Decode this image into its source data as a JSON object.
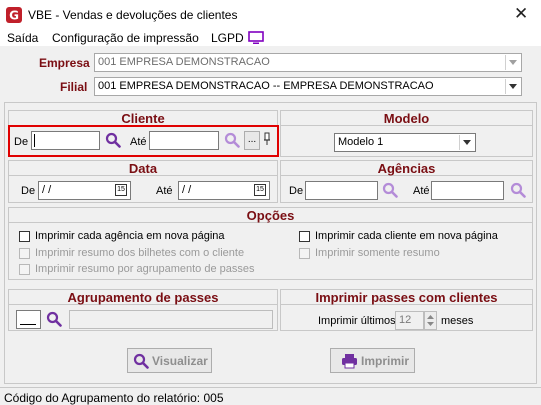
{
  "window": {
    "title": "VBE - Vendas e devoluções de clientes",
    "close_glyph": "✕"
  },
  "menu": {
    "items": [
      "Saída",
      "Configuração de impressão",
      "LGPD"
    ]
  },
  "header": {
    "empresa_label": "Empresa",
    "empresa_value": "001 EMPRESA DEMONSTRACAO",
    "filial_label": "Filial",
    "filial_value": "001 EMPRESA DEMONSTRACAO -- EMPRESA DEMONSTRACAO"
  },
  "cliente": {
    "title": "Cliente",
    "de_label": "De",
    "ate_label": "Até",
    "ellipsis": "..."
  },
  "modelo": {
    "title": "Modelo",
    "value": "Modelo 1"
  },
  "data": {
    "title": "Data",
    "de_label": "De",
    "de_value": " /  /",
    "ate_label": "Até",
    "ate_value": " /  /",
    "cal_day": "15"
  },
  "agencias": {
    "title": "Agências",
    "de_label": "De",
    "ate_label": "Até"
  },
  "opcoes": {
    "title": "Opções",
    "left": [
      {
        "label": "Imprimir cada agência em nova página",
        "enabled": true
      },
      {
        "label": "Imprimir resumo dos bilhetes com o cliente",
        "enabled": false
      },
      {
        "label": "Imprimir resumo por agrupamento de passes",
        "enabled": false
      }
    ],
    "right": [
      {
        "label": "Imprimir cada cliente em nova página",
        "enabled": true
      },
      {
        "label": "Imprimir somente resumo",
        "enabled": false
      }
    ]
  },
  "agrupamento": {
    "title": "Agrupamento de passes"
  },
  "passes": {
    "title": "Imprimir passes com clientes",
    "label": "Imprimir últimos",
    "value": "12",
    "unit": "meses"
  },
  "buttons": {
    "visualizar": "Visualizar",
    "imprimir": "Imprimir"
  },
  "status": {
    "text": "Código do Agrupamento do relatório: 005"
  },
  "colors": {
    "section_title": "#7a0e13",
    "highlight_border": "#e00000",
    "search_icon": "#7030a0",
    "lgpd_icon": "#8000c0"
  }
}
